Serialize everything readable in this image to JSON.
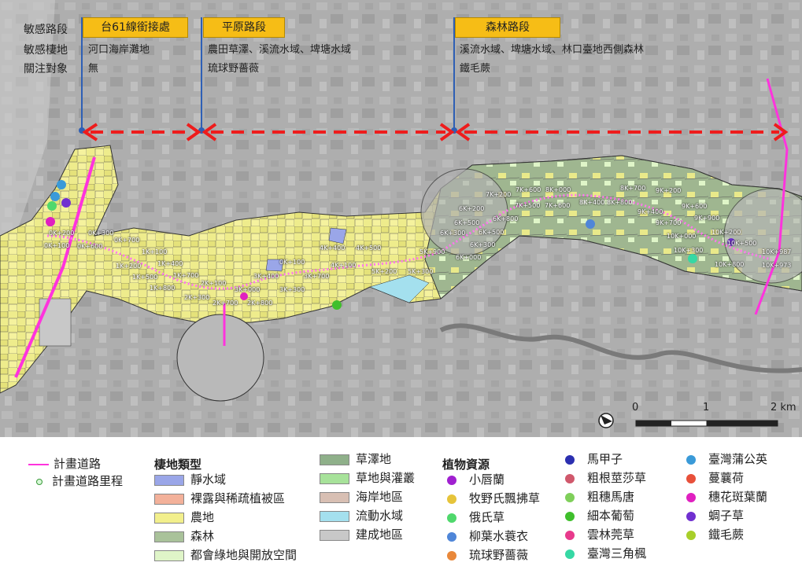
{
  "sections": {
    "row_labels": [
      "敏感路段",
      "敏感棲地",
      "關注對象"
    ],
    "items": [
      {
        "name": "台61線銜接處",
        "habitat": "河口海岸灘地",
        "focus": "無"
      },
      {
        "name": "平原路段",
        "habitat": "農田草澤、溪流水域、埤塘水域",
        "focus": "琉球野薔薇"
      },
      {
        "name": "森林路段",
        "habitat": "溪流水域、埤塘水域、林口臺地西側森林",
        "focus": "鐵毛蕨"
      }
    ]
  },
  "mileage": [
    "0K+200",
    "0K+300",
    "0K+100",
    "0K+600",
    "0K+700",
    "1K+100",
    "1K+200",
    "1K+400",
    "1K+500",
    "1K+700",
    "1K+800",
    "2K+100",
    "2K+300",
    "2K+700",
    "2K+800",
    "3K+000",
    "3K+300",
    "3K+400",
    "3K+700",
    "0K+100",
    "4K+100",
    "4K+400",
    "4K+500",
    "5K+200",
    "5K+300",
    "5K+900",
    "6K+000",
    "6K+200",
    "6K+300",
    "6K+500",
    "6K+800",
    "7K+200",
    "7K+500",
    "7K+600",
    "8K+000",
    "8K+400",
    "8K+700",
    "8K+800",
    "9K+200",
    "9K+400",
    "9K+600",
    "9K+700",
    "9K+900",
    "10K+000",
    "10K+200",
    "10K+300",
    "10K+500",
    "10K+800",
    "10K+987",
    "10K+973",
    "6K+500",
    "7K+600",
    "6K+300"
  ],
  "scale": {
    "ticks": [
      "0",
      "1",
      "2 km"
    ]
  },
  "legend": {
    "road_label": "計畫道路",
    "milepost_label": "計畫道路里程",
    "habitat_title": "棲地類型",
    "habitats": [
      {
        "label": "靜水域",
        "color": "#9aa6e8"
      },
      {
        "label": "裸露與稀疏植被區",
        "color": "#f3b19a"
      },
      {
        "label": "農地",
        "color": "#f2ef8c"
      },
      {
        "label": "森林",
        "color": "#a9c29a"
      },
      {
        "label": "都會綠地與開放空間",
        "color": "#dff5c8"
      },
      {
        "label": "草澤地",
        "color": "#8fb08a"
      },
      {
        "label": "草地與灌叢",
        "color": "#a7e29a"
      },
      {
        "label": "海岸地區",
        "color": "#d8bfb3"
      },
      {
        "label": "流動水域",
        "color": "#a4e0ee"
      },
      {
        "label": "建成地區",
        "color": "#c8c8c8"
      }
    ],
    "plant_title": "植物資源",
    "plants": [
      {
        "label": "小唇蘭",
        "color": "#a020d0"
      },
      {
        "label": "牧野氏飄拂草",
        "color": "#e6c43a"
      },
      {
        "label": "俄氏草",
        "color": "#4fd86c"
      },
      {
        "label": "柳葉水蓑衣",
        "color": "#4f86d8"
      },
      {
        "label": "琉球野薔薇",
        "color": "#e9883a"
      },
      {
        "label": "馬甲子",
        "color": "#2b2fb0"
      },
      {
        "label": "粗根莖莎草",
        "color": "#d0586c"
      },
      {
        "label": "粗穗馬唐",
        "color": "#7fcf5a"
      },
      {
        "label": "細本葡萄",
        "color": "#3fbf2c"
      },
      {
        "label": "雲林莞草",
        "color": "#e83a8c"
      },
      {
        "label": "臺灣三角楓",
        "color": "#36d8a4"
      },
      {
        "label": "臺灣蒲公英",
        "color": "#3a9ad8"
      },
      {
        "label": "蔓蘘荷",
        "color": "#e8503a"
      },
      {
        "label": "穗花斑葉蘭",
        "color": "#e020c0"
      },
      {
        "label": "蜩子草",
        "color": "#7030d0"
      },
      {
        "label": "鐵毛蕨",
        "color": "#a8cf2a"
      }
    ]
  }
}
